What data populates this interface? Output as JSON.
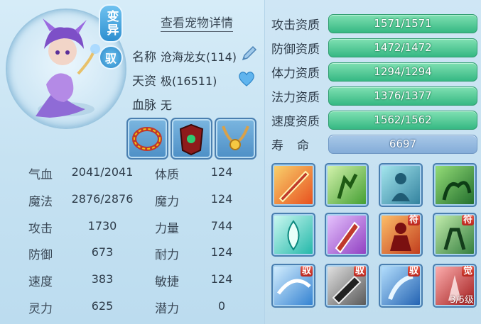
{
  "header": {
    "variant_badge": "变异",
    "ride_badge": "驭",
    "details_link": "查看宠物详情"
  },
  "info": {
    "name_label": "名称",
    "name_value": "沧海龙女(114)",
    "talent_label": "天资",
    "talent_value": "极(16511)",
    "bloodline_label": "血脉",
    "bloodline_value": "无"
  },
  "stats_left": [
    {
      "label": "气血",
      "value": "2041/2041"
    },
    {
      "label": "魔法",
      "value": "2876/2876"
    },
    {
      "label": "攻击",
      "value": "1730"
    },
    {
      "label": "防御",
      "value": "673"
    },
    {
      "label": "速度",
      "value": "383"
    },
    {
      "label": "灵力",
      "value": "625"
    }
  ],
  "stats_right": [
    {
      "label": "体质",
      "value": "124"
    },
    {
      "label": "魔力",
      "value": "124"
    },
    {
      "label": "力量",
      "value": "744"
    },
    {
      "label": "耐力",
      "value": "124"
    },
    {
      "label": "敏捷",
      "value": "124"
    },
    {
      "label": "潜力",
      "value": "0"
    }
  ],
  "aptitudes": [
    {
      "label": "攻击资质",
      "value": "1571/1571"
    },
    {
      "label": "防御资质",
      "value": "1472/1472"
    },
    {
      "label": "体力资质",
      "value": "1294/1294"
    },
    {
      "label": "法力资质",
      "value": "1376/1377"
    },
    {
      "label": "速度资质",
      "value": "1562/1562"
    }
  ],
  "lifespan": {
    "label": "寿　命",
    "value": "6697"
  },
  "skills": {
    "tag_fu": "符",
    "tag_yu": "驭",
    "tag_jue": "觉",
    "awaken_level": "3/5级"
  },
  "colors": {
    "bar_green": "#36b883",
    "bar_blue": "#84acd8",
    "accent": "#2e8fd0"
  }
}
